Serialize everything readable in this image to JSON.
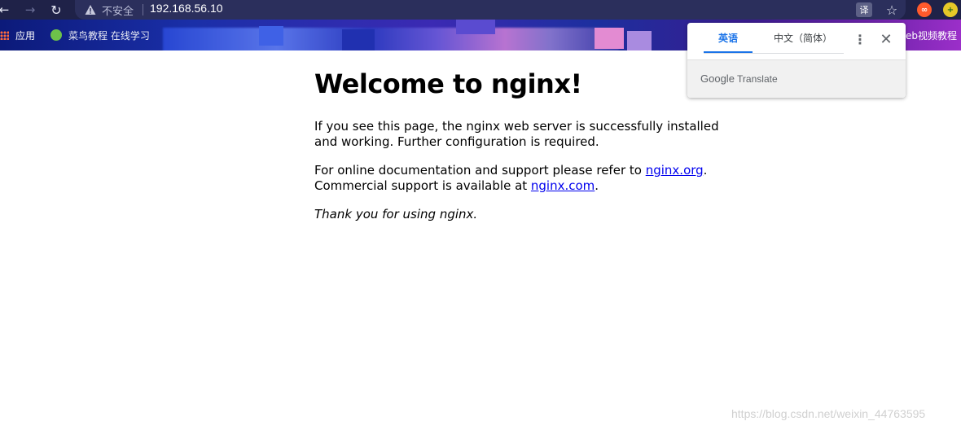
{
  "toolbar": {
    "back_icon": "arrow-left-icon",
    "forward_icon": "arrow-right-icon",
    "reload_icon": "reload-icon",
    "security_label": "不安全",
    "url": "192.168.56.10",
    "translate_icon_glyph": "译",
    "bookmark_icon": "star-icon"
  },
  "bookmarks_bar": {
    "apps_label": "应用",
    "item1_label": "菜鸟教程 在线学习",
    "item_right_label": "eb视频教程"
  },
  "page": {
    "heading": "Welcome to nginx!",
    "para1": "If you see this page, the nginx web server is successfully installed and working. Further configuration is required.",
    "para2_prefix": "For online documentation and support please refer to ",
    "link1": "nginx.org",
    "para2_mid": ".",
    "para2_line2": "Commercial support is available at ",
    "link2": "nginx.com",
    "para2_suffix": ".",
    "thanks": "Thank you for using nginx."
  },
  "translate_popup": {
    "tabs": [
      {
        "label": "英语",
        "active": true
      },
      {
        "label": "中文（简体）",
        "active": false
      }
    ],
    "footer_brand": "Google",
    "footer_product": "Translate"
  },
  "watermark": "https://blog.csdn.net/weixin_44763595",
  "colors": {
    "toolbar_bg": "#1f2248",
    "link": "#0000ee",
    "popup_active": "#1a73e8"
  }
}
